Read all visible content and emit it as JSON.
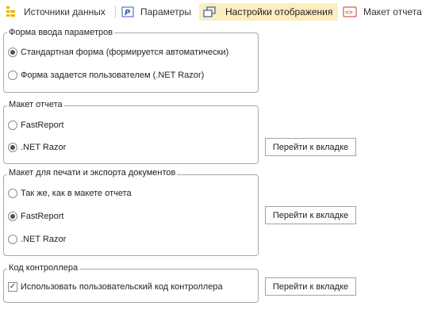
{
  "tabs": [
    {
      "label": "Источники данных",
      "icon": "data-sources-icon",
      "active": false
    },
    {
      "label": "Параметры",
      "icon": "parameters-icon",
      "active": false
    },
    {
      "label": "Настройки отображения",
      "icon": "display-settings-icon",
      "active": true
    },
    {
      "label": "Макет отчета",
      "icon": "report-layout-icon",
      "active": false
    }
  ],
  "input_form": {
    "title": "Форма ввода параметров",
    "options": [
      {
        "label": "Стандартная форма (формируется автоматически)",
        "selected": true
      },
      {
        "label": "Форма задается пользователем (.NET Razor)",
        "selected": false
      }
    ]
  },
  "report_layout": {
    "title": "Макет отчета",
    "options": [
      {
        "label": "FastReport",
        "selected": false
      },
      {
        "label": ".NET Razor",
        "selected": true
      }
    ],
    "button": "Перейти к вкладке"
  },
  "print_layout": {
    "title": "Макет для печати и экспорта документов",
    "options": [
      {
        "label": "Так же, как в макете отчета",
        "selected": false
      },
      {
        "label": "FastReport",
        "selected": true
      },
      {
        "label": ".NET Razor",
        "selected": false
      }
    ],
    "button": "Перейти к вкладке"
  },
  "controller": {
    "title": "Код контроллера",
    "checkbox_label": "Использовать пользовательский код контроллера",
    "checked": true,
    "button": "Перейти к вкладке"
  },
  "colors": {
    "active_tab_bg": "#fbeec0",
    "group_border": "#a8a8a8"
  }
}
